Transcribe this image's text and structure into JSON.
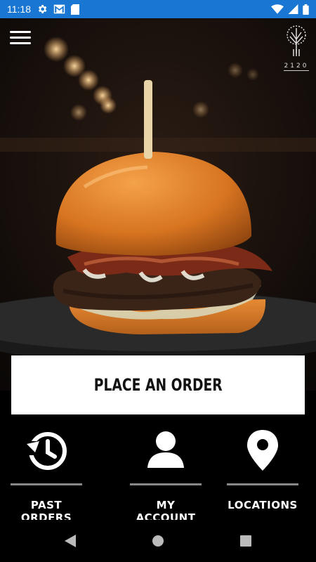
{
  "status_bar": {
    "time": "11:18",
    "background": "#1976d2"
  },
  "header": {
    "logo_text": "2120"
  },
  "hero": {
    "image": "burger-photo"
  },
  "order_button": {
    "label": "PLACE AN ORDER"
  },
  "bottom_nav": {
    "items": [
      {
        "label": "PAST ORDERS",
        "icon": "history-icon"
      },
      {
        "label": "MY ACCOUNT",
        "icon": "account-icon"
      },
      {
        "label": "LOCATIONS",
        "icon": "location-pin-icon"
      }
    ]
  }
}
